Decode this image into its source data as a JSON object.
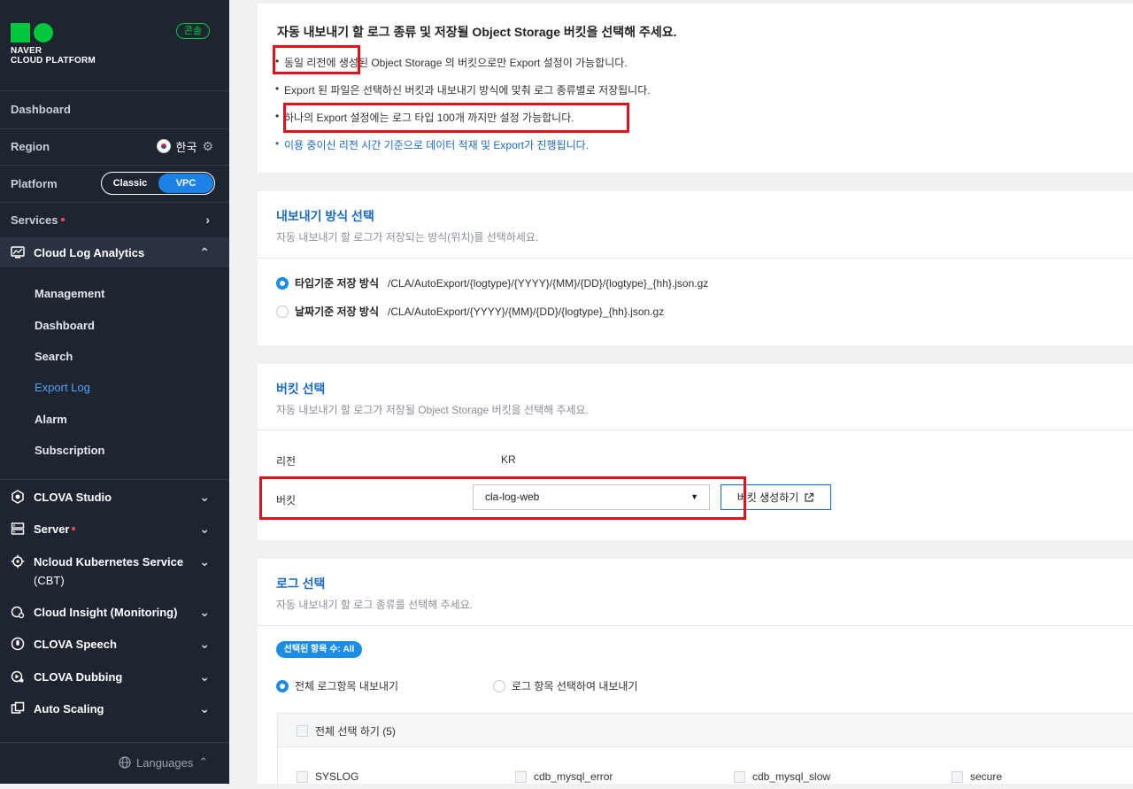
{
  "sidebar": {
    "logo_line1": "NAVER",
    "logo_line2": "CLOUD PLATFORM",
    "console_badge": "콘솔",
    "dashboard": "Dashboard",
    "region_label": "Region",
    "region_value": "한국",
    "platform_label": "Platform",
    "platform_options": [
      "Classic",
      "VPC"
    ],
    "platform_selected": "VPC",
    "services_label": "Services",
    "services": [
      {
        "label": "Cloud Log Analytics",
        "icon": "monitor-chart-icon",
        "expanded": true
      },
      {
        "label": "CLOVA Studio",
        "icon": "hexagon-icon"
      },
      {
        "label": "Server",
        "icon": "server-icon",
        "dot": true
      },
      {
        "label": "Ncloud Kubernetes Service",
        "label2": "(CBT)",
        "icon": "helm-icon"
      },
      {
        "label": "Cloud Insight (Monitoring)",
        "icon": "insight-icon"
      },
      {
        "label": "CLOVA Speech",
        "icon": "speech-icon"
      },
      {
        "label": "CLOVA Dubbing",
        "icon": "dubbing-icon"
      },
      {
        "label": "Auto Scaling",
        "icon": "scaling-icon"
      }
    ],
    "cla_sub": [
      "Management",
      "Dashboard",
      "Search",
      "Export Log",
      "Alarm",
      "Subscription"
    ],
    "cla_active": "Export Log",
    "languages": "Languages"
  },
  "info": {
    "title": "자동 내보내기 할 로그 종류 및 저장될 Object Storage 버킷을 선택해 주세요.",
    "bullets": [
      "동일 리전에 생성된 Object Storage 의 버킷으로만 Export 설정이 가능합니다.",
      "Export 된 파일은 선택하신 버킷과 내보내기 방식에 맞춰 로그 종류별로 저장됩니다.",
      "하나의 Export 설정에는 로그 타입 100개 까지만 설정 가능합니다.",
      "이용 중이신 리전 시간 기준으로 데이터 적재 및 Export가 진행됩니다."
    ]
  },
  "export_method": {
    "title": "내보내기 방식 선택",
    "subtitle": "자동 내보내기 할 로그가 저장되는 방식(위치)를 선택하세요.",
    "options": [
      {
        "label": "타입기준 저장 방식",
        "path": "/CLA/AutoExport/{logtype}/{YYYY}/{MM}/{DD}/{logtype}_{hh}.json.gz",
        "selected": true
      },
      {
        "label": "날짜기준 저장 방식",
        "path": "/CLA/AutoExport/{YYYY}/{MM}/{DD}/{logtype}_{hh}.json.gz",
        "selected": false
      }
    ]
  },
  "bucket": {
    "title": "버킷 선택",
    "subtitle": "자동 내보내기 할 로그가 저장될 Object Storage 버킷을 선택해 주세요.",
    "region_label": "리전",
    "region_value": "KR",
    "bucket_label": "버킷",
    "bucket_value": "cla-log-web",
    "create_button": "버킷 생성하기"
  },
  "log_select": {
    "title": "로그 선택",
    "subtitle": "자동 내보내기 할 로그 종류를 선택해 주세요.",
    "badge": "선택된 항목 수: All",
    "options": [
      {
        "label": "전체 로그항목 내보내기",
        "selected": true
      },
      {
        "label": "로그 항목 선택하여 내보내기",
        "selected": false
      }
    ],
    "select_all": "전체 선택 하기 (5)",
    "items": [
      "SYSLOG",
      "cdb_mysql_error",
      "cdb_mysql_slow",
      "secure"
    ]
  },
  "colors": {
    "sidebar_bg": "#1f2431",
    "accent_blue": "#1c8de6",
    "highlight_red": "#e3101b",
    "brand_green": "#00c73c"
  }
}
